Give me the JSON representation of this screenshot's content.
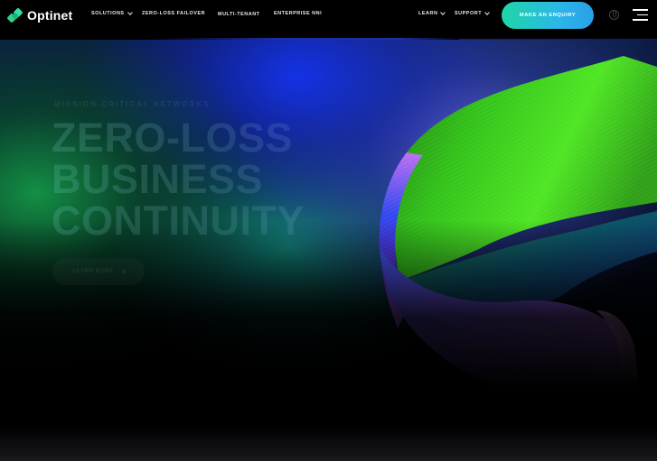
{
  "brand": {
    "name": "Optinet",
    "accent": "#2fd28a"
  },
  "nav": {
    "items": [
      {
        "label": "SOLUTIONS",
        "dropdown": true
      },
      {
        "label": "ZERO-LOSS FAILOVER",
        "dropdown": false
      },
      {
        "label": "MULTI-TENANT",
        "dropdown": false
      },
      {
        "label": "ENTERPRISE NNI",
        "dropdown": false
      },
      {
        "label": "LEARN",
        "dropdown": true
      },
      {
        "label": "SUPPORT",
        "dropdown": true
      }
    ],
    "cta_label": "MAKE AN ENQUIRY",
    "cta_color": "#2ab8e6"
  },
  "hero": {
    "eyebrow": "MISSION-CRITICAL NETWORKS",
    "headline_lines": [
      "ZERO-LOSS",
      "BUSINESS",
      "CONTINUITY"
    ],
    "button_label": "LEARN MORE",
    "ribbon_colors": {
      "green": "#3ee21f",
      "blue": "#2a3ee8",
      "violet": "#c86ee8"
    }
  },
  "icons": {
    "dropdown": "chevron-down-icon",
    "language": "globe-icon",
    "menu": "hamburger-menu-icon",
    "hero_button": "chevron-right-icon"
  }
}
